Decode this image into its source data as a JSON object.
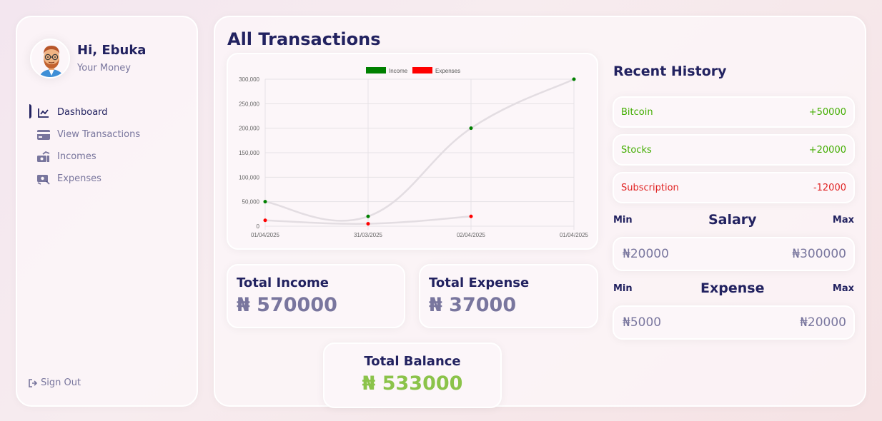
{
  "user": {
    "greeting": "Hi, Ebuka",
    "subtitle": "Your Money"
  },
  "menu": [
    {
      "label": "Dashboard",
      "icon": "chart-line-icon",
      "active": true
    },
    {
      "label": "View Transactions",
      "icon": "credit-card-icon",
      "active": false
    },
    {
      "label": "Incomes",
      "icon": "money-bill-trend-up-icon",
      "active": false
    },
    {
      "label": "Expenses",
      "icon": "money-bill-trend-down-icon",
      "active": false
    }
  ],
  "signout_label": "Sign Out",
  "page_title": "All Transactions",
  "chart_data": {
    "type": "line",
    "x": [
      "01/04/2025",
      "31/03/2025",
      "02/04/2025",
      "01/04/2025"
    ],
    "series": [
      {
        "name": "Income",
        "color": "#008000",
        "values": [
          50000,
          20000,
          200000,
          300000
        ]
      },
      {
        "name": "Expenses",
        "color": "#ff0000",
        "values": [
          12000,
          5000,
          20000
        ]
      }
    ],
    "yticks": [
      "0",
      "50,000",
      "100,000",
      "150,000",
      "200,000",
      "250,000",
      "300,000"
    ],
    "ylim": [
      0,
      300000
    ],
    "grid": true,
    "legend_position": "top-center"
  },
  "totals": {
    "income_title": "Total Income",
    "income_value": "₦ 570000",
    "expense_title": "Total Expense",
    "expense_value": "₦ 37000",
    "balance_title": "Total Balance",
    "balance_value": "₦ 533000"
  },
  "recent": {
    "title": "Recent History",
    "items": [
      {
        "name": "Bitcoin",
        "amount": "+50000",
        "type": "income"
      },
      {
        "name": "Stocks",
        "amount": "+20000",
        "type": "income"
      },
      {
        "name": "Subscription",
        "amount": "-12000",
        "type": "expense"
      }
    ]
  },
  "salary": {
    "min_label": "Min",
    "title": "Salary",
    "max_label": "Max",
    "min_value": "₦20000",
    "max_value": "₦300000"
  },
  "expense_range": {
    "min_label": "Min",
    "title": "Expense",
    "max_label": "Max",
    "min_value": "₦5000",
    "max_value": "₦20000"
  },
  "colors": {
    "navy": "#222260",
    "income_green": "#42ad00",
    "expense_red": "#e02323",
    "balance_green": "#8bc34a"
  }
}
